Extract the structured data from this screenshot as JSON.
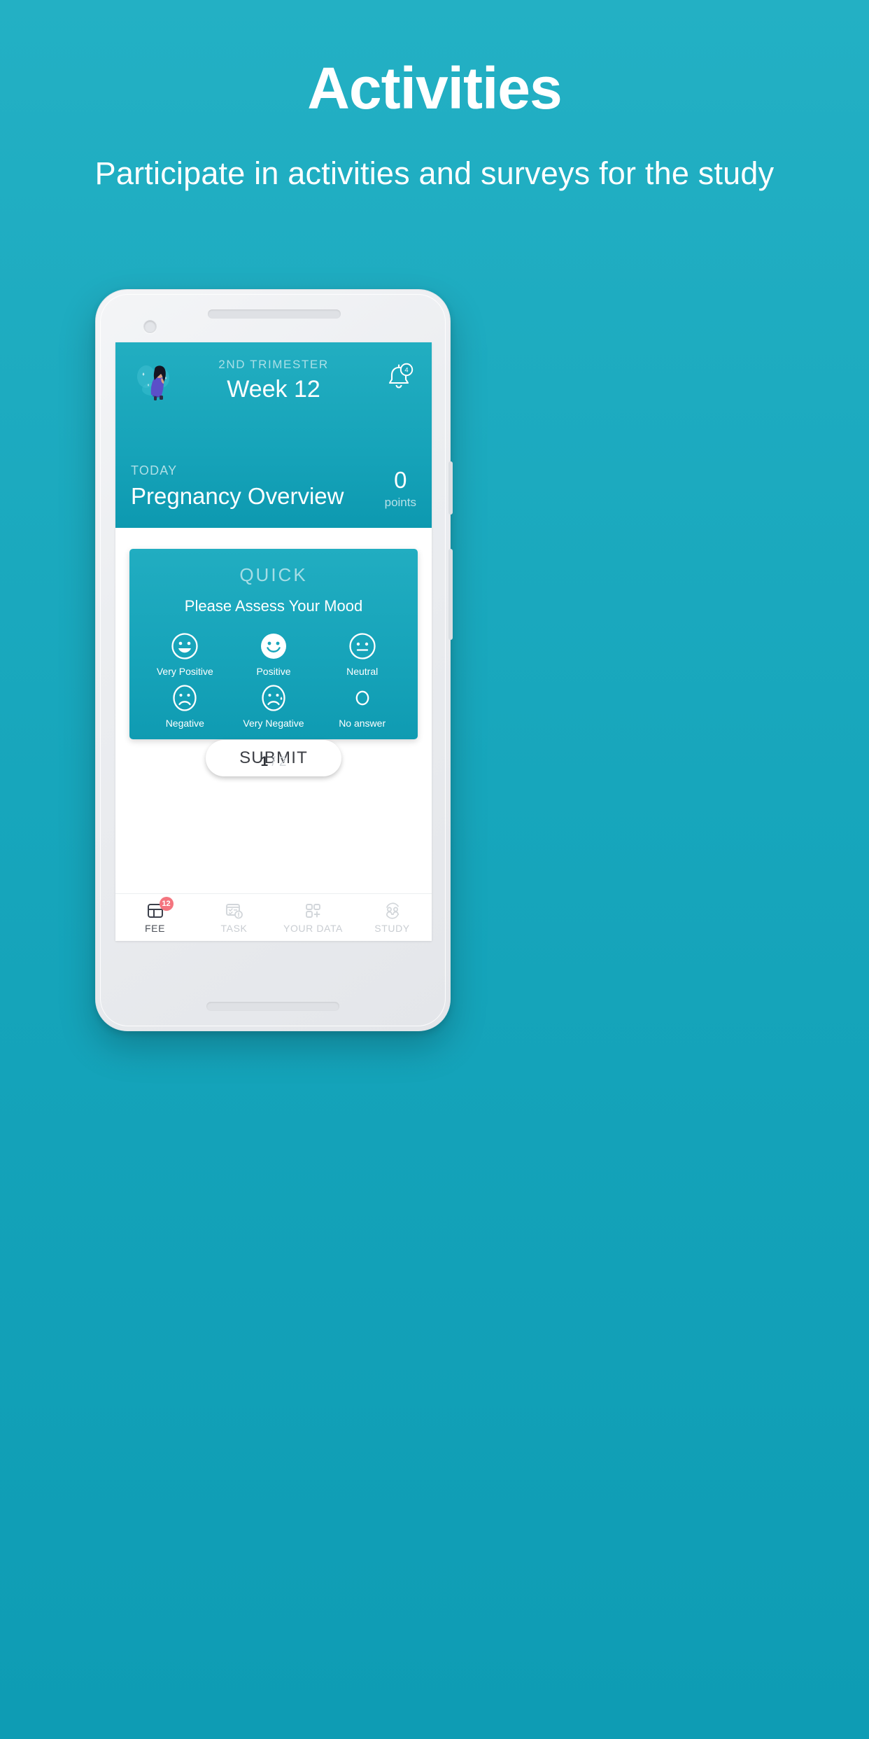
{
  "promo": {
    "title": "Activities",
    "subtitle": "Participate in activities and surveys for the study"
  },
  "colors": {
    "background_teal": "#17a6bc",
    "card_teal": "#17a4ba",
    "badge_red": "#f4757f",
    "white": "#ffffff",
    "nav_inactive": "#c9cdd2",
    "nav_active": "#4c5159"
  },
  "app": {
    "header": {
      "avatar_icon": "pregnant-woman-illustration",
      "trimester": "2ND TRIMESTER",
      "week": "Week 12",
      "notification_icon": "bell-icon",
      "notification_count": "4",
      "today_label": "TODAY",
      "today_title": "Pregnancy Overview",
      "points_value": "0",
      "points_label": "points"
    },
    "quick_card": {
      "kicker": "QUICK",
      "question": "Please Assess Your Mood",
      "moods": [
        {
          "label": "Very Positive",
          "icon": "smiley-grin-outline-icon",
          "selected": false
        },
        {
          "label": "Positive",
          "icon": "smiley-smile-filled-icon",
          "selected": true
        },
        {
          "label": "Neutral",
          "icon": "smiley-neutral-outline-icon",
          "selected": false
        },
        {
          "label": "Negative",
          "icon": "smiley-frown-outline-icon",
          "selected": false
        },
        {
          "label": "Very Negative",
          "icon": "smiley-crying-outline-icon",
          "selected": false
        },
        {
          "label": "No answer",
          "icon": "empty-circle-icon",
          "selected": false
        }
      ],
      "submit_label": "SUBMIT"
    },
    "pagination": {
      "current": "1",
      "separator": "/",
      "total": "2"
    },
    "nav": [
      {
        "label": "FEE",
        "icon": "feed-cards-icon",
        "badge": "12",
        "active": true
      },
      {
        "label": "TASK",
        "icon": "task-list-icon",
        "badge": "",
        "active": false
      },
      {
        "label": "YOUR DATA",
        "icon": "data-blocks-plus-icon",
        "badge": "",
        "active": false
      },
      {
        "label": "STUDY",
        "icon": "study-people-icon",
        "badge": "",
        "active": false
      }
    ]
  }
}
